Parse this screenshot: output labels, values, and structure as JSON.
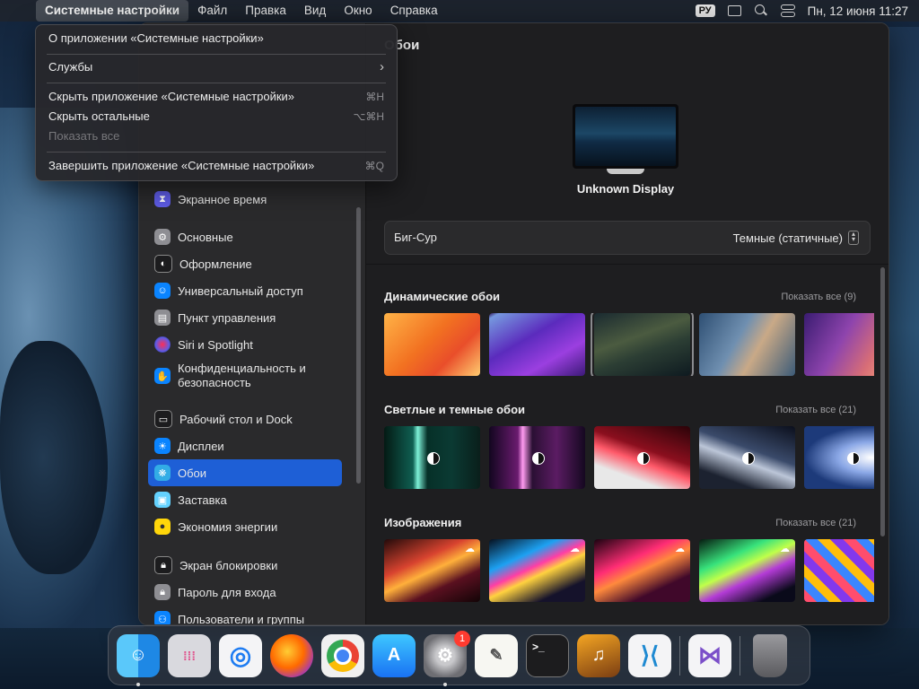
{
  "menubar": {
    "app_name": "Системные настройки",
    "menus": [
      "Файл",
      "Правка",
      "Вид",
      "Окно",
      "Справка"
    ],
    "input_source": "РУ",
    "datetime": "Пн, 12 июня  11:27"
  },
  "app_menu": {
    "items": [
      {
        "label": "О приложении «Системные настройки»",
        "shortcut": ""
      },
      {
        "label": "Службы",
        "shortcut": "›"
      },
      {
        "label": "Скрыть приложение «Системные настройки»",
        "shortcut": "⌘H"
      },
      {
        "label": "Скрыть остальные",
        "shortcut": "⌥⌘H"
      },
      {
        "label": "Показать все",
        "shortcut": ""
      },
      {
        "label": "Завершить приложение «Системные настройки»",
        "shortcut": "⌘Q"
      }
    ]
  },
  "sidebar": {
    "items": [
      {
        "label": "Экранное время",
        "icon": "hourglass-icon",
        "color": "#5e5ce6"
      },
      {
        "label": "Основные",
        "icon": "gear-icon",
        "color": "#8e8e93"
      },
      {
        "label": "Оформление",
        "icon": "appearance-icon",
        "color": "#1c1c1e"
      },
      {
        "label": "Универсальный доступ",
        "icon": "accessibility-icon",
        "color": "#0a84ff"
      },
      {
        "label": "Пункт управления",
        "icon": "control-center-icon",
        "color": "#8e8e93"
      },
      {
        "label": "Siri и Spotlight",
        "icon": "siri-icon",
        "color": "#bf5af2"
      },
      {
        "label": "Конфиденциальность и безопасность",
        "icon": "hand-icon",
        "color": "#0a84ff"
      },
      {
        "label": "Рабочий стол и Dock",
        "icon": "dock-icon",
        "color": "#1c1c1e"
      },
      {
        "label": "Дисплеи",
        "icon": "sun-icon",
        "color": "#0a84ff"
      },
      {
        "label": "Обои",
        "icon": "wallpaper-icon",
        "color": "#32ade6"
      },
      {
        "label": "Заставка",
        "icon": "screensaver-icon",
        "color": "#64d2ff"
      },
      {
        "label": "Экономия энергии",
        "icon": "bulb-icon",
        "color": "#ffd60a"
      },
      {
        "label": "Экран блокировки",
        "icon": "lock-icon",
        "color": "#1c1c1e"
      },
      {
        "label": "Пароль для входа",
        "icon": "lock-icon",
        "color": "#8e8e93"
      },
      {
        "label": "Пользователи и группы",
        "icon": "users-icon",
        "color": "#0a84ff"
      }
    ],
    "selected": "Обои"
  },
  "wallpaper": {
    "title": "Обои",
    "display_name": "Unknown Display",
    "current": "Биг-Сур",
    "mode": "Темные (статичные)",
    "sections": [
      {
        "title": "Динамические обои",
        "show_all": "Показать все (9)"
      },
      {
        "title": "Светлые и темные обои",
        "show_all": "Показать все (21)"
      },
      {
        "title": "Изображения",
        "show_all": "Показать все (21)"
      }
    ]
  },
  "dock": {
    "apps": [
      "Finder",
      "Launchpad",
      "Safari",
      "Firefox",
      "Chrome",
      "App Store",
      "Системные настройки",
      "TextEdit",
      "Терминал",
      "GarageBand",
      "Visual Studio Code",
      "Visual Studio",
      "Корзина"
    ],
    "notification_count": "1"
  }
}
